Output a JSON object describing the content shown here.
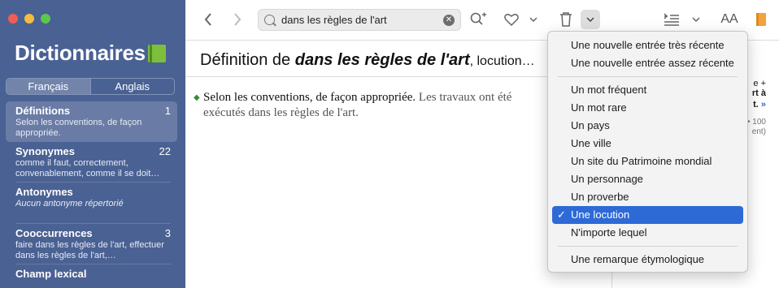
{
  "sidebar": {
    "app_title": "Dictionnaires",
    "lang_tabs": [
      "Français",
      "Anglais"
    ],
    "items": [
      {
        "title": "Définitions",
        "count": "1",
        "desc": "Selon les conventions, de façon appropriée."
      },
      {
        "title": "Synonymes",
        "count": "22",
        "desc": "comme il faut, correctement, convenablement, comme il se doit…"
      },
      {
        "title": "Antonymes",
        "count": "",
        "desc": "Aucun antonyme répertorié"
      },
      {
        "title": "Cooccurrences",
        "count": "3",
        "desc": "faire dans les règles de l'art, effectuer dans les règles de l'art,…"
      },
      {
        "title": "Champ lexical",
        "count": "",
        "desc": ""
      }
    ]
  },
  "toolbar": {
    "search_value": "dans les règles de l'art",
    "font_size_label": "AA",
    "icons": [
      "back-icon",
      "forward-icon",
      "search-icon",
      "clear-icon",
      "zoom-add-icon",
      "heart-icon",
      "chevron-down-icon",
      "trash-icon",
      "chevron-down-icon",
      "list-icon",
      "chevron-down-icon",
      "text-size-icon",
      "bookmark-icon"
    ]
  },
  "definition": {
    "prefix": "Définition de ",
    "term": "dans les règles de l'art",
    "category": ", locution…",
    "text": "Selon les conventions, de façon appropriée.",
    "example": "Les travaux ont été exécutés dans les règles de l'art."
  },
  "right_col": {
    "line1": "e +",
    "line2": "rt à",
    "line3": "t.",
    "more": "»",
    "meta1": "• 100",
    "meta2": "ent)"
  },
  "menu": {
    "group1": [
      "Une nouvelle entrée très récente",
      "Une nouvelle entrée assez récente"
    ],
    "group2": [
      "Un mot fréquent",
      "Un mot rare",
      "Un pays",
      "Une ville",
      "Un site du Patrimoine mondial",
      "Un personnage",
      "Un proverbe",
      "Une locution",
      "N'importe lequel"
    ],
    "group3": [
      "Une remarque étymologique"
    ],
    "checked": "Une locution",
    "check_glyph": "✓"
  }
}
